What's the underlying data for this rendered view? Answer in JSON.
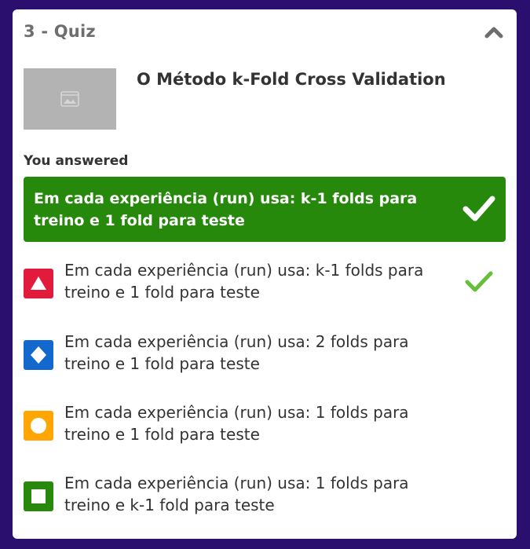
{
  "quiz": {
    "title": "3 - Quiz",
    "question": "O Método k-Fold Cross Validation",
    "you_answered_label": "You answered",
    "selected_answer": "Em cada experiência (run) usa: k-1 folds para treino e 1 fold para teste",
    "options": [
      {
        "shape": "triangle-icon",
        "color": "#e21b3c",
        "text": "Em cada experiência (run) usa: k-1 folds para treino e 1 fold para teste",
        "correct": true
      },
      {
        "shape": "diamond-icon",
        "color": "#1368ce",
        "text": "Em cada experiência (run) usa: 2 folds para treino e 1 fold para teste",
        "correct": false
      },
      {
        "shape": "circle-icon",
        "color": "#ffa602",
        "text": "Em cada experiência (run) usa: 1 folds para treino e 1 fold para teste",
        "correct": false
      },
      {
        "shape": "square-icon",
        "color": "#26890c",
        "text": "Em cada experiência (run) usa: 1 folds para treino e k-1 fold para teste",
        "correct": false
      }
    ]
  },
  "colors": {
    "background": "#2a0f6e",
    "correct_green": "#26890c",
    "check_light_green": "#66bf39"
  }
}
